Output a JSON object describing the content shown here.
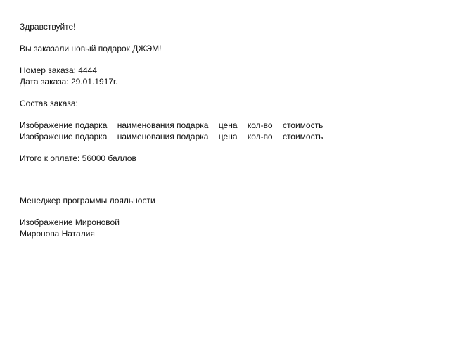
{
  "greeting": "Здравствуйте!",
  "intro": "Вы заказали новый подарок ДЖЭМ!",
  "order": {
    "number_label": "Номер заказа:",
    "number_value": "4444",
    "date_label": "Дата заказа:",
    "date_value": "29.01.1917г."
  },
  "composition": {
    "title": "Состав заказа:",
    "rows": [
      {
        "image": "Изображение подарка",
        "name": "наименования подарка",
        "price": "цена",
        "qty": "кол-во",
        "cost": "стоимость"
      },
      {
        "image": "Изображение подарка",
        "name": "наименования подарка",
        "price": "цена",
        "qty": "кол-во",
        "cost": "стоимость"
      }
    ]
  },
  "total": {
    "label": "Итого к оплате:",
    "value": "56000 баллов"
  },
  "signature": {
    "role": "Менеджер программы лояльности",
    "image_placeholder": "Изображение Мироновой",
    "name": "Миронова Наталия"
  }
}
